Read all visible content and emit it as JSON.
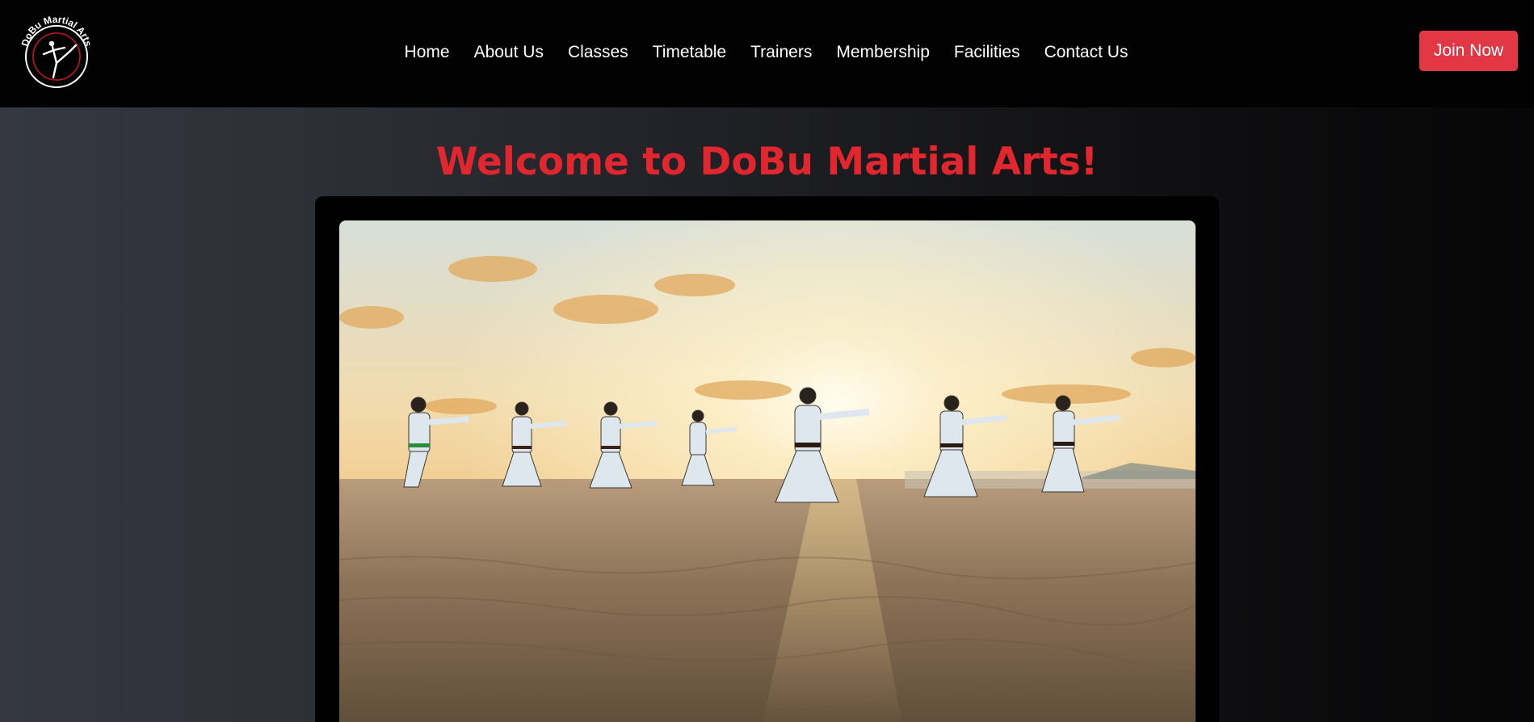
{
  "brand": {
    "logo_text": "DoBu Martial Arts",
    "logo_icon": "karate-kick-icon"
  },
  "nav": {
    "items": [
      {
        "label": "Home"
      },
      {
        "label": "About Us"
      },
      {
        "label": "Classes"
      },
      {
        "label": "Timetable"
      },
      {
        "label": "Trainers"
      },
      {
        "label": "Membership"
      },
      {
        "label": "Facilities"
      },
      {
        "label": "Contact Us"
      }
    ]
  },
  "cta": {
    "join_label": "Join Now"
  },
  "hero": {
    "title": "Welcome to DoBu Martial Arts!",
    "image_alt": "Group of karate students training on a beach at sunset"
  },
  "colors": {
    "accent": "#e0262e",
    "button": "#e23744",
    "header_bg": "#020203"
  }
}
